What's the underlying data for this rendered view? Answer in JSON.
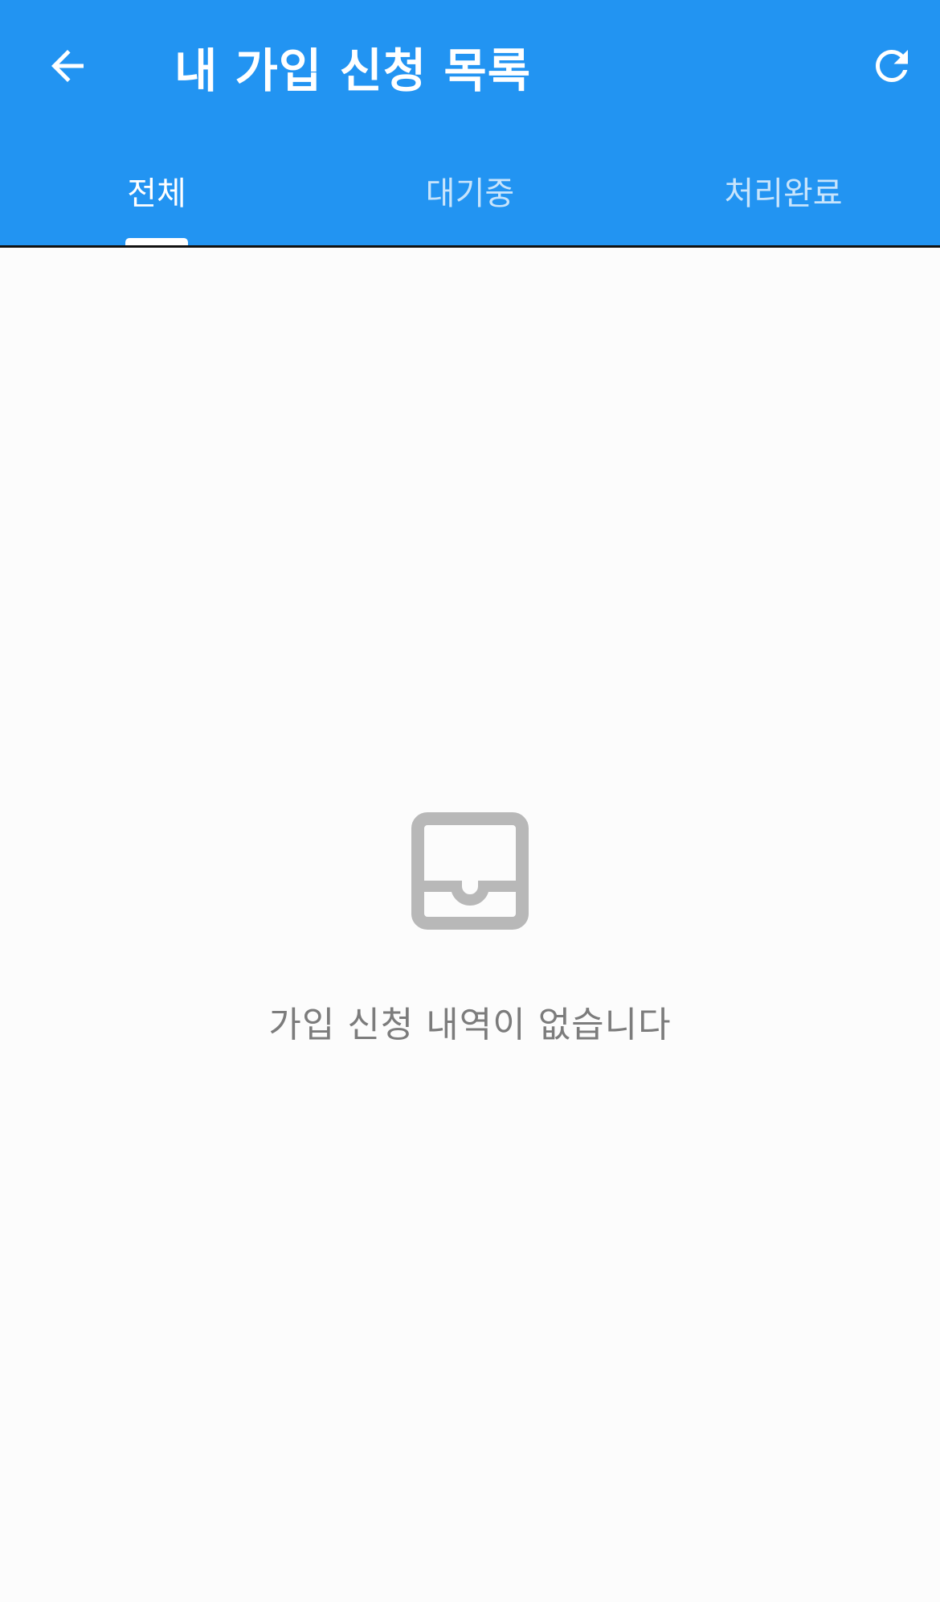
{
  "header": {
    "title": "내 가입 신청 목록",
    "back_icon": "arrow-left-icon",
    "refresh_icon": "refresh-icon",
    "background_color": "#2294f2"
  },
  "tabs": [
    {
      "label": "전체",
      "active": true
    },
    {
      "label": "대기중",
      "active": false
    },
    {
      "label": "처리완료",
      "active": false
    }
  ],
  "empty_state": {
    "icon": "inbox-icon",
    "message": "가입 신청 내역이 없습니다"
  }
}
